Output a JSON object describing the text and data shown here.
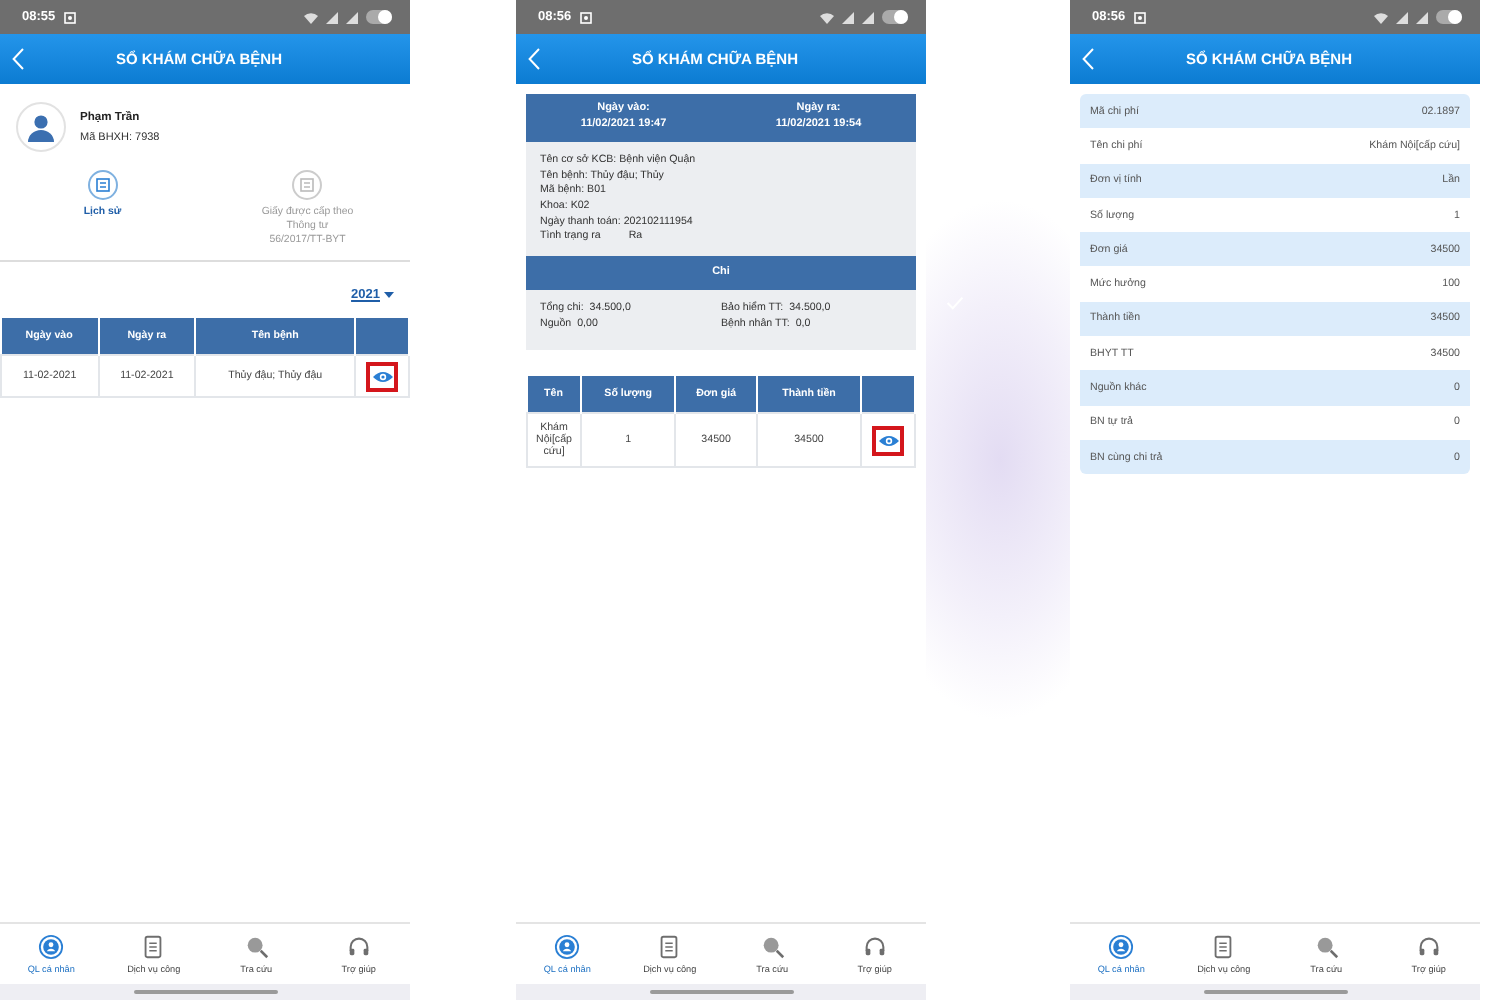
{
  "screens": [
    {
      "kind": "profile",
      "status_time": "08:55",
      "title": "SỔ KHÁM CHỮA BỆNH",
      "patient": {
        "name": "Phạm Trần",
        "id": "Mã BHXH: 7938"
      },
      "actions": [
        {
          "label": "Lịch sử",
          "selected": true
        },
        {
          "label": "Giấy được cấp theo Thông tư 56/2017/TT-BYT",
          "selected": false
        }
      ],
      "year": "2021",
      "table": {
        "columns": [
          "Ngày vào",
          "Ngày ra",
          "Tên bệnh"
        ],
        "rows": [
          {
            "cells": [
              "11-02-2021",
              "11-02-2021",
              "Thủy đậu; Thủy đậu"
            ],
            "marked": true
          }
        ]
      },
      "nav": [
        {
          "label": "QL cá nhân",
          "selected": true
        },
        {
          "label": "Dịch vụ công",
          "selected": false
        },
        {
          "label": "Tra cứu",
          "selected": false
        },
        {
          "label": "Trợ giúp",
          "selected": false
        }
      ]
    },
    {
      "kind": "visit",
      "status_time": "08:56",
      "title": "SỔ KHÁM CHỮA BỆNH",
      "dates": [
        {
          "label": "Ngày vào:",
          "value": "11/02/2021 19:47"
        },
        {
          "label": "Ngày ra:",
          "value": "11/02/2021 19:54"
        }
      ],
      "info": [
        "Tên cơ sở KCB: Bệnh viện Quận",
        "Tên bệnh: Thủy đậu; Thủy",
        "Mã bệnh: B01",
        "Khoa: K02",
        "Ngày thanh toán: 202102111954"
      ],
      "status": {
        "label": "Tình trạng ra",
        "value": "Ra"
      },
      "section": "Chi",
      "totals": [
        {
          "label": "Tổng chi:",
          "value": "34.500,0"
        },
        {
          "label": "Bảo hiểm TT:",
          "value": "34.500,0"
        },
        {
          "label": "Nguồn",
          "value": "0,00"
        },
        {
          "label": "Bệnh nhân TT:",
          "value": "0,0"
        }
      ],
      "table": {
        "columns": [
          "Tên",
          "Số lượng",
          "Đơn giá",
          "Thành tiền"
        ],
        "rows": [
          {
            "cells": [
              "Khám Nội[cấp cứu]",
              "1",
              "34500",
              "34500"
            ],
            "marked": true
          }
        ]
      },
      "nav": [
        {
          "label": "QL cá nhân",
          "selected": true
        },
        {
          "label": "Dịch vụ công",
          "selected": false
        },
        {
          "label": "Tra cứu",
          "selected": false
        },
        {
          "label": "Trợ giúp",
          "selected": false
        }
      ]
    },
    {
      "kind": "cost",
      "status_time": "08:56",
      "title": "SỔ KHÁM CHỮA BỆNH",
      "rows": [
        {
          "label": "Mã chi phí",
          "value": "02.1897"
        },
        {
          "label": "Tên chi phí",
          "value": "Khám Nội[cấp cứu]"
        },
        {
          "label": "Đơn vị tính",
          "value": "Lần"
        },
        {
          "label": "Số lượng",
          "value": "1"
        },
        {
          "label": "Đơn giá",
          "value": "34500"
        },
        {
          "label": "Mức hưởng",
          "value": "100"
        },
        {
          "label": "Thành tiền",
          "value": "34500"
        },
        {
          "label": "BHYT TT",
          "value": "34500"
        },
        {
          "label": "Nguồn khác",
          "value": "0"
        },
        {
          "label": "BN tự trả",
          "value": "0"
        },
        {
          "label": "BN cùng chi trả",
          "value": "0"
        }
      ],
      "nav": [
        {
          "label": "QL cá nhân",
          "selected": true
        },
        {
          "label": "Dịch vụ công",
          "selected": false
        },
        {
          "label": "Tra cứu",
          "selected": false
        },
        {
          "label": "Trợ giúp",
          "selected": false
        }
      ]
    }
  ]
}
